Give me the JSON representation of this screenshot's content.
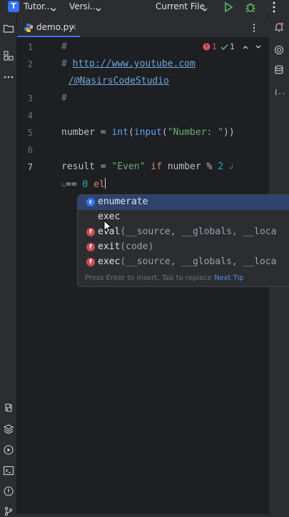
{
  "topbar": {
    "project_badge": "T",
    "project_name": "Tutor...",
    "vcs_name": "Versi...",
    "run_config": "Current File",
    "icons": [
      "chevron-down-icon",
      "run-icon",
      "debug-icon",
      "more-vertical-icon"
    ]
  },
  "tab": {
    "file_name": "demo.py",
    "close": "×"
  },
  "inspections": {
    "errors": "1",
    "warnings": "1"
  },
  "editor": {
    "lines": [
      {
        "num": "1",
        "text": "#"
      },
      {
        "num": "2",
        "text": "# http://www.youtube.com",
        "cont": "/@NasirsCodeStudio"
      },
      {
        "num": "3",
        "text": "#"
      },
      {
        "num": "4",
        "text": ""
      },
      {
        "num": "5",
        "text": "number = int(input(\"Number: \"))"
      },
      {
        "num": "6",
        "text": ""
      },
      {
        "num": "7",
        "text": "result = \"Even\" if number % 2 ",
        "cont": "== 0 el"
      }
    ]
  },
  "completion": {
    "items": [
      {
        "label": "enumerate",
        "params": "",
        "icon": "class-icon"
      },
      {
        "label": "exec",
        "params": "",
        "icon": "none"
      },
      {
        "label": "eval",
        "params": "(__source, __globals, __loca",
        "icon": "function-icon"
      },
      {
        "label": "exit",
        "params": "(code)",
        "icon": "function-icon"
      },
      {
        "label": "exec",
        "params": "(__source, __globals, __loca",
        "icon": "function-icon"
      }
    ],
    "footer_text": "Press Enter to insert, Tab to replace",
    "footer_tip": "Next Tip"
  },
  "colors": {
    "accent": "#3574f0",
    "editor_bg": "#1e1f22",
    "panel_bg": "#2b2d30",
    "error_red": "#e55765",
    "ok_green": "#5fb865"
  }
}
